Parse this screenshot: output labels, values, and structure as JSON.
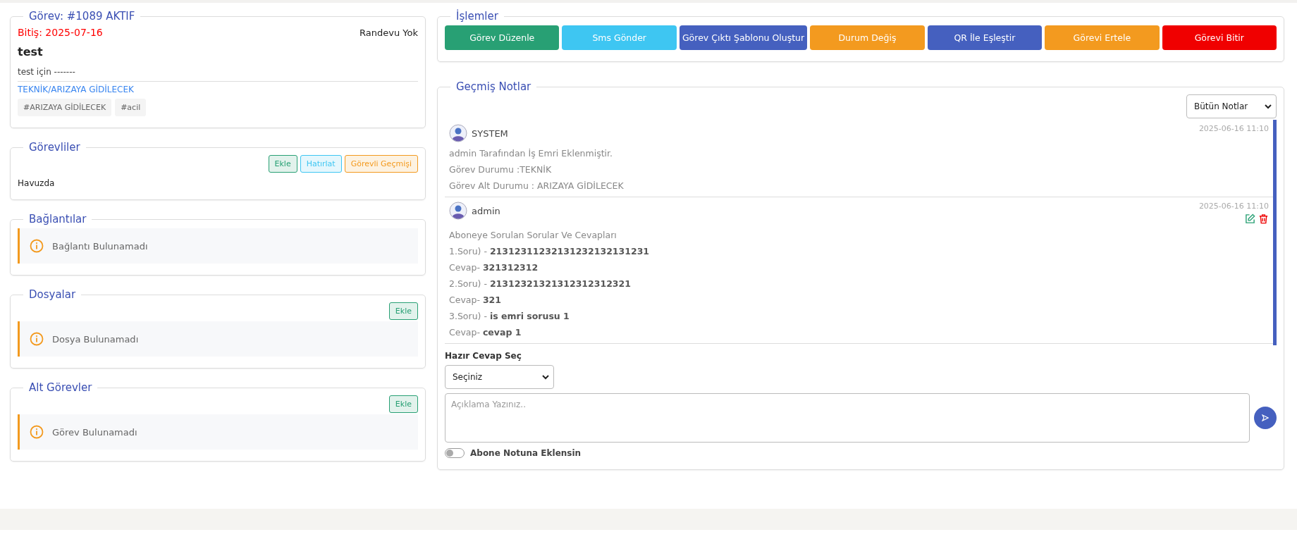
{
  "task": {
    "title": "Görev: #1089 AKTIF",
    "due": "Bitiş: 2025-07-16",
    "appointment": "Randevu Yok",
    "name": "test",
    "description": "test için -------",
    "status_path": "TEKNİK/ARIZAYA GİDİLECEK",
    "tags": [
      "#ARIZAYA GİDİLECEK",
      "#acil"
    ]
  },
  "assignees": {
    "title": "Görevliler",
    "buttons": [
      {
        "label": "Ekle",
        "color": "#28a074"
      },
      {
        "label": "Hatırlat",
        "color": "#3ec6f2"
      },
      {
        "label": "Görevli Geçmişi",
        "color": "#f39a1f"
      }
    ],
    "text": "Havuzda"
  },
  "sections": [
    {
      "title": "Bağlantılar",
      "message": "Bağlantı Bulunamadı"
    },
    {
      "title": "Dosyalar",
      "add_button": "Ekle",
      "message": "Dosya Bulunamadı"
    },
    {
      "title": "Alt Görevler",
      "add_button": "Ekle",
      "message": "Görev Bulunamadı"
    }
  ],
  "actions": {
    "title": "İşlemler",
    "buttons": [
      {
        "label": "Görev Düzenle",
        "color": "#28a074"
      },
      {
        "label": "Sms Gönder",
        "color": "#3ec6f2"
      },
      {
        "label": "Görev Çıktı Şablonu Oluştur",
        "color": "#4560bf"
      },
      {
        "label": "Durum Değiş",
        "color": "#f39a1f"
      },
      {
        "label": "QR İle Eşleştir",
        "color": "#4560bf"
      },
      {
        "label": "Görevi Ertele",
        "color": "#f39a1f"
      },
      {
        "label": "Görevi Bitir",
        "color": "#f00000"
      }
    ]
  },
  "notes": {
    "title": "Geçmiş Notlar",
    "filter": "Bütün Notlar",
    "items": [
      {
        "author": "SYSTEM",
        "date": "2025-06-16 11:10",
        "editable": false,
        "lines": [
          "admin Tarafından İş Emri Eklenmiştir.",
          "Görev Durumu :TEKNİK",
          "Görev Alt Durumu : ARIZAYA GİDİLECEK"
        ]
      },
      {
        "author": "admin",
        "date": "2025-06-16 11:10",
        "editable": true,
        "lines": [
          "Aboneye Sorulan Sorular Ve Cevapları",
          "1.Soru) - **21312311232131232132131231**",
          "Cevap- **321312312**",
          "2.Soru) - **21312321321312312312321**",
          "Cevap- **321**",
          "3.Soru) - **is emri sorusu 1**",
          "Cevap- **cevap 1**"
        ]
      }
    ],
    "ready_answer_label": "Hazır Cevap Seç",
    "ready_answer_value": "Seçiniz",
    "comment_placeholder": "Açıklama Yazınız..",
    "subscriber_toggle": {
      "label": "Abone Notuna Eklensin",
      "on": false
    }
  }
}
